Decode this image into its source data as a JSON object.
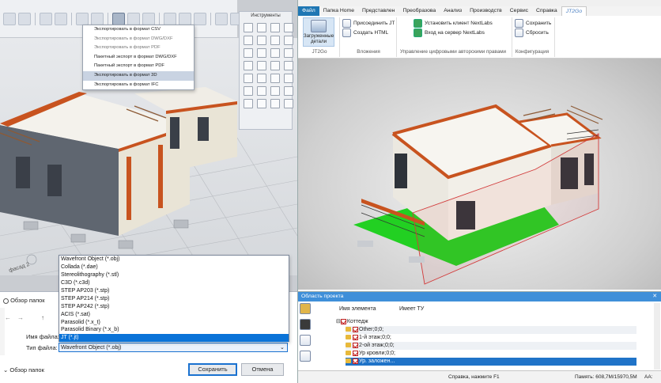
{
  "left_app": {
    "export_menu": {
      "items": [
        {
          "label": "Экспортировать в формат CSV",
          "state": "normal"
        },
        {
          "label": "Экспортировать в формат DWG/DXF",
          "state": "disabled"
        },
        {
          "label": "Экспортировать в формат PDF",
          "state": "disabled"
        },
        {
          "label": "Пакетный экспорт в формат DWG/DXF",
          "state": "normal"
        },
        {
          "label": "Пакетный экспорт в формат PDF",
          "state": "normal"
        },
        {
          "label": "Экспортировать в формат 3D",
          "state": "selected"
        },
        {
          "label": "Экспортировать в формат IFC",
          "state": "normal"
        }
      ]
    },
    "tools_panel": {
      "title": "Инструменты"
    },
    "scene_labels": {
      "axis": "фасад 2"
    }
  },
  "file_dialog": {
    "title": "Обзор папок",
    "file_name_label": "Имя файла:",
    "file_type_label": "Тип файла:",
    "file_type_value": "Wavefront Object (*.obj)",
    "browse_folders": "Обзор папок",
    "save_button": "Сохранить",
    "cancel_button": "Отмена",
    "file_types": [
      "Wavefront Object (*.obj)",
      "Collada (*.dae)",
      "Stereolithography (*.stl)",
      "C3D (*.c3d)",
      "STEP AP203 (*.stp)",
      "STEP AP214 (*.stp)",
      "STEP AP242 (*.stp)",
      "ACIS (*.sat)",
      "Parasolid (*.x_t)",
      "Parasolid Binary (*.x_b)",
      "JT (*.jt)"
    ],
    "selected_type": "JT (*.jt)"
  },
  "right_app": {
    "tabs": [
      "Файл",
      "Папка Home",
      "Представлен",
      "Преобразова",
      "Анализ",
      "Производств",
      "Сервис",
      "Справка",
      "JT2Go"
    ],
    "active_tab": "JT2Go",
    "ribbon": {
      "loaded_parts": "Загруженные детали",
      "attach_jt": "Присоединить JT",
      "create_html": "Создать HTML",
      "install_nextlabs": "Установить клиент NextLabs",
      "login_nextlabs": "Вход на сервер NextLabs",
      "save": "Сохранить",
      "reset": "Сбросить",
      "group_jt2go": "JT2Go",
      "group_attachments": "Вложения",
      "group_drm": "Управление цифровыми авторскими правами",
      "group_config": "Конфигурация"
    },
    "project_panel": {
      "title": "Область проекта",
      "col_name": "Имя элемента",
      "col_has": "Имеет ТУ",
      "rows": [
        {
          "label": "Коттедж",
          "level": 0,
          "selected": false
        },
        {
          "label": "Other;0;0;",
          "level": 1,
          "selected": false
        },
        {
          "label": "1-й этаж;0;0;",
          "level": 1,
          "selected": false
        },
        {
          "label": "2-ой этаж;0;0;",
          "level": 1,
          "selected": false
        },
        {
          "label": "Ур кровли;0;0;",
          "level": 1,
          "selected": false
        },
        {
          "label": "Ур. заложен...",
          "level": 1,
          "selected": true
        }
      ]
    },
    "status": {
      "help": "Справка, нажмите F1",
      "memory": "Память: 608,7M/15970,5M",
      "keys": "AA:"
    }
  },
  "colors": {
    "accent_blue": "#1f77b4",
    "selection_blue": "#0a73d8",
    "wall_orange": "#c8531f",
    "ground_green": "#22d022"
  }
}
